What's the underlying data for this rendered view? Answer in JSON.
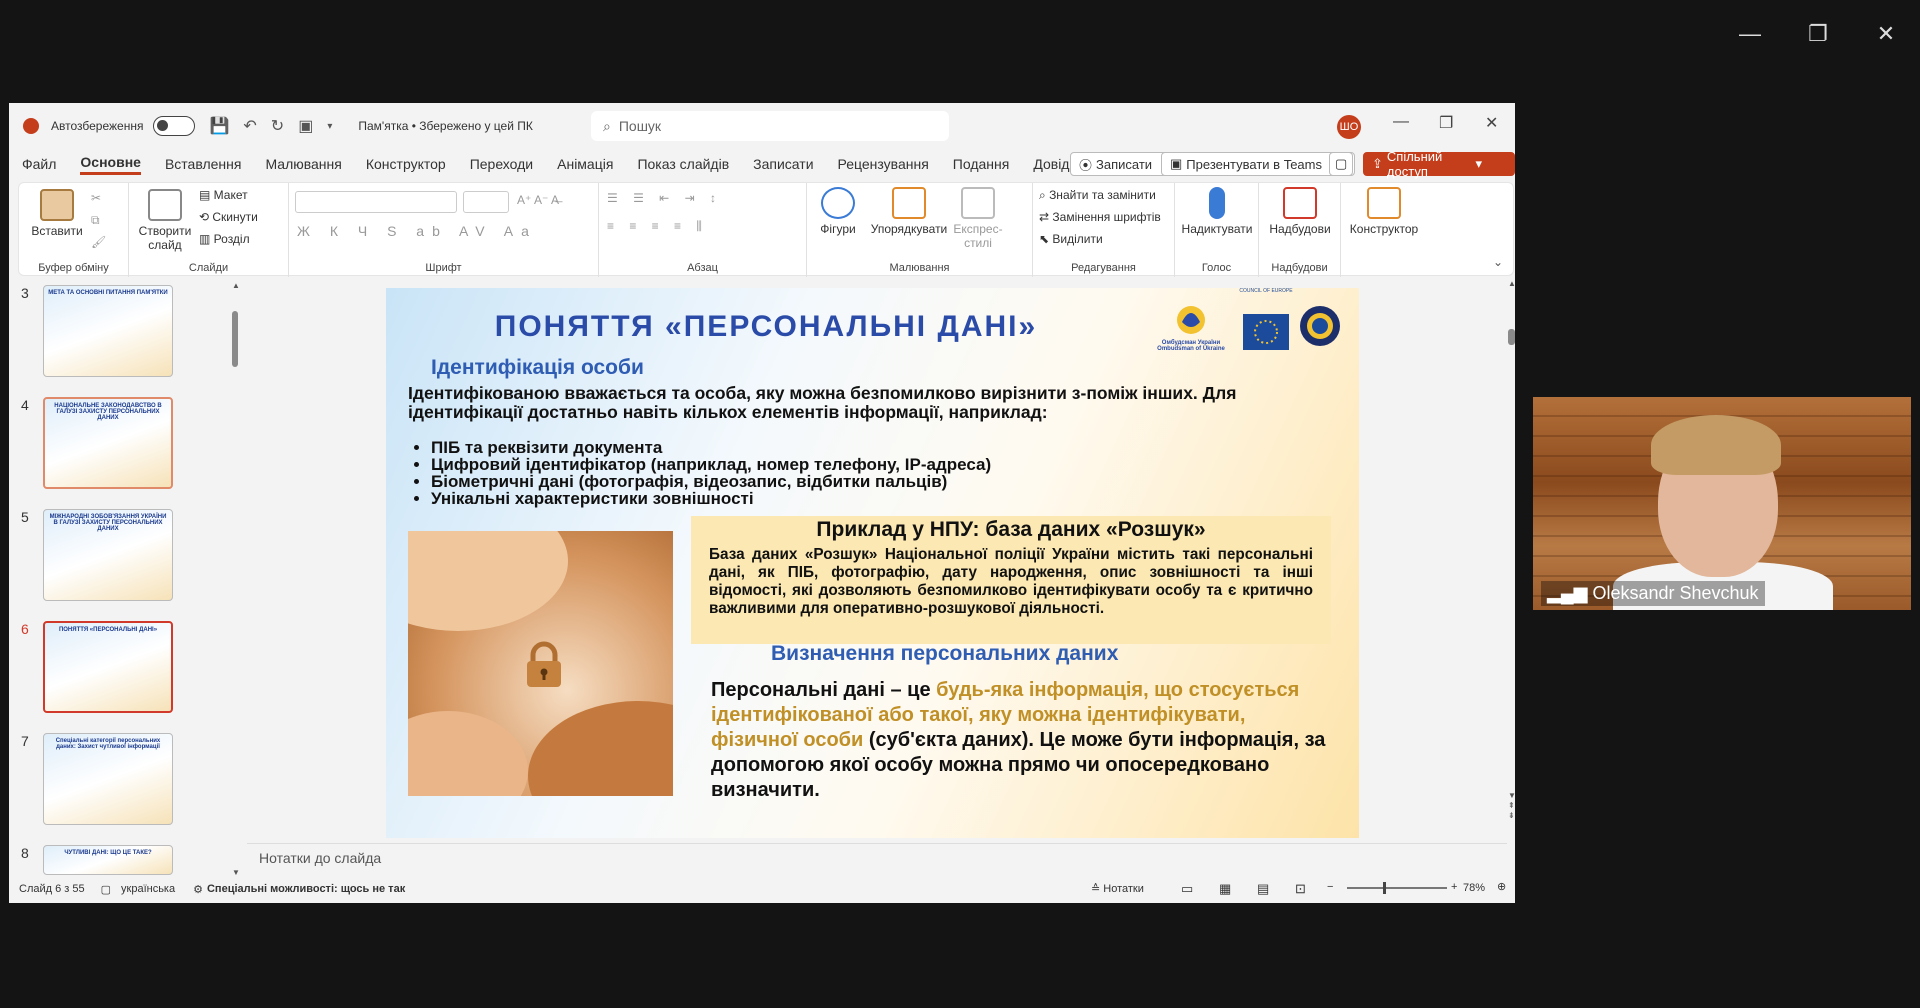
{
  "window_controls": {
    "minimize": "—",
    "restore": "❐",
    "close": "✕"
  },
  "titlebar": {
    "autosave_label": "Автозбереження",
    "document_title": "Пам'ятка • Збережено у цей ПК",
    "search_placeholder": "Пошук",
    "avatar_initials": "ШО"
  },
  "tabs": [
    "Файл",
    "Основне",
    "Вставлення",
    "Малювання",
    "Конструктор",
    "Переходи",
    "Анімація",
    "Показ слайдів",
    "Записати",
    "Рецензування",
    "Подання",
    "Довідка"
  ],
  "tab_buttons": {
    "record": "Записати",
    "teams": "Презентувати в Teams",
    "share": "Спільний доступ"
  },
  "ribbon": {
    "clipboard": {
      "paste": "Вставити",
      "label": "Буфер обміну"
    },
    "slides": {
      "new_slide": "Створити слайд",
      "layout": "Макет",
      "reset": "Скинути",
      "sections": "Розділ",
      "label": "Слайди"
    },
    "font": {
      "label": "Шрифт"
    },
    "paragraph": {
      "label": "Абзац"
    },
    "drawing": {
      "shapes": "Фігури",
      "arrange": "Упорядкувати",
      "quick_styles": "Експрес-стилі",
      "label": "Малювання"
    },
    "editing": {
      "find": "Знайти та замінити",
      "replace_fonts": "Замінення шрифтів",
      "select": "Виділити",
      "label": "Редагування"
    },
    "voice": {
      "dictate": "Надиктувати",
      "label": "Голос"
    },
    "addins": {
      "addins": "Надбудови",
      "label": "Надбудови"
    },
    "designer": {
      "designer": "Конструктор"
    }
  },
  "thumbnails": [
    {
      "num": "3",
      "title": "МЕТА ТА ОСНОВНІ ПИТАННЯ ПАМ'ЯТКИ"
    },
    {
      "num": "4",
      "title": "НАЦІОНАЛЬНЕ ЗАКОНОДАВСТВО В ГАЛУЗІ ЗАХИСТУ ПЕРСОНАЛЬНИХ ДАНИХ"
    },
    {
      "num": "5",
      "title": "МІЖНАРОДНІ ЗОБОВ'ЯЗАННЯ УКРАЇНИ В ГАЛУЗІ ЗАХИСТУ ПЕРСОНАЛЬНИХ ДАНИХ"
    },
    {
      "num": "6",
      "title": "ПОНЯТТЯ «ПЕРСОНАЛЬНІ ДАНІ»"
    },
    {
      "num": "7",
      "title": "Спеціальні категорії персональних даних: Захист чутливої інформації"
    },
    {
      "num": "8",
      "title": "ЧУТЛИВІ ДАНІ: ЩО ЦЕ ТАКЕ?"
    }
  ],
  "slide": {
    "title": "ПОНЯТТЯ «ПЕРСОНАЛЬНІ ДАНІ»",
    "logo_ombudsman": "Омбудсман України Ombudsman of Ukraine",
    "logo_coe": "COUNCIL OF EUROPE",
    "ident_heading": "Ідентифікація особи",
    "ident_text": "Ідентифікованою вважається та особа, яку можна безпомилково вирізнити з-поміж інших. Для ідентифікації достатньо навіть кількох елементів інформації, наприклад:",
    "bullets": [
      "ПІБ та реквізити документа",
      "Цифровий ідентифікатор (наприклад, номер телефону, IP-адреса)",
      "Біометричні дані (фотографія, відеозапис, відбитки пальців)",
      "Унікальні характеристики зовнішності"
    ],
    "npu_heading": "Приклад у НПУ: база даних «Розшук»",
    "npu_text": "База даних «Розшук» Національної поліції України містить такі персональні дані, як ПІБ, фотографію, дату народження, опис зовнішності та інші відомості, які дозволяють безпомилково ідентифікувати особу та є критично важливими для оперативно-розшукової діяльності.",
    "def_heading": "Визначення персональних даних",
    "def_part1": "Персональні дані – це ",
    "def_highlight": "будь-яка інформація, що стосується ідентифікованої або такої, яку можна ідентифікувати, фізичної особи",
    "def_part2": " (суб'єкта даних). Це може бути інформація, за допомогою якої особу можна прямо чи опосередковано визначити."
  },
  "notes_placeholder": "Нотатки до слайда",
  "status": {
    "slide_count": "Слайд 6 з 55",
    "language": "українська",
    "accessibility": "Спеціальні можливості: щось не так",
    "notes": "Нотатки",
    "zoom": "78%"
  },
  "video": {
    "participant": "Oleksandr Shevchuk"
  },
  "colors": {
    "accent": "#c43e1c",
    "title_blue": "#2a4ba8",
    "highlight_gold": "#c09027"
  }
}
